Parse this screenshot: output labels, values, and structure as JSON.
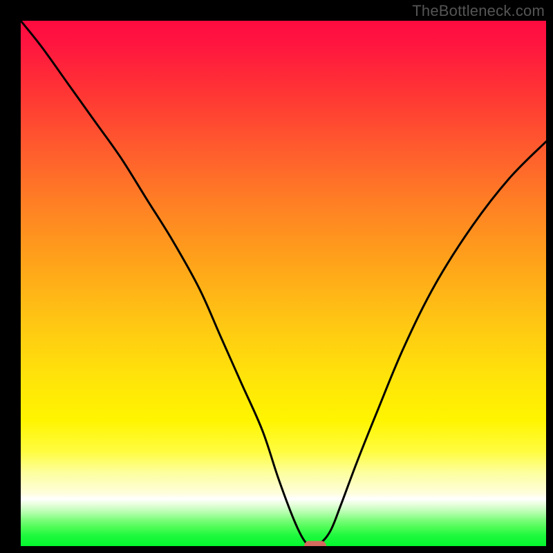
{
  "watermark": "TheBottleneck.com",
  "chart_data": {
    "type": "line",
    "title": "",
    "xlabel": "",
    "ylabel": "",
    "xlim": [
      0,
      100
    ],
    "ylim": [
      0,
      100
    ],
    "grid": false,
    "legend": false,
    "background_gradient": {
      "top": "#ff0b3f",
      "bottom": "#04f72f",
      "stops": [
        {
          "pos": 0.0,
          "color": "#ff0b3f"
        },
        {
          "pos": 0.5,
          "color": "#ffb015"
        },
        {
          "pos": 0.8,
          "color": "#fffb20"
        },
        {
          "pos": 0.91,
          "color": "#ffffff"
        },
        {
          "pos": 1.0,
          "color": "#04f72f"
        }
      ]
    },
    "series": [
      {
        "name": "bottleneck-curve",
        "x": [
          0,
          4,
          9,
          14,
          19,
          24,
          29,
          34,
          38,
          42,
          46,
          49,
          52,
          54,
          55.5,
          57,
          59,
          61,
          64,
          68,
          73,
          79,
          86,
          93,
          100
        ],
        "y": [
          100,
          95,
          88,
          81,
          74,
          66,
          58,
          49,
          40,
          31,
          22,
          13,
          5,
          1,
          0,
          0.5,
          3,
          8,
          16,
          26,
          38,
          50,
          61,
          70,
          77
        ]
      }
    ],
    "marker": {
      "name": "optimal-point",
      "x": 56,
      "y": 0,
      "color": "#d46a5f"
    }
  }
}
